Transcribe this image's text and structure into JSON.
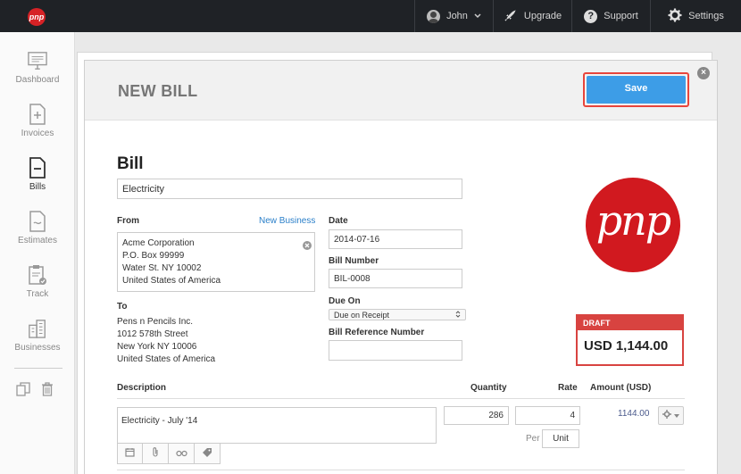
{
  "topbar": {
    "logo_text": "pnp",
    "user": "John",
    "upgrade": "Upgrade",
    "support": "Support",
    "settings": "Settings"
  },
  "sidebar": {
    "items": [
      {
        "label": "Dashboard",
        "icon": "monitor-icon"
      },
      {
        "label": "Invoices",
        "icon": "invoice-plus-icon"
      },
      {
        "label": "Bills",
        "icon": "bill-minus-icon"
      },
      {
        "label": "Estimates",
        "icon": "estimate-icon"
      },
      {
        "label": "Track",
        "icon": "clipboard-check-icon"
      },
      {
        "label": "Businesses",
        "icon": "buildings-icon"
      }
    ],
    "active": "Bills",
    "tools": [
      "copy-icon",
      "trash-icon"
    ]
  },
  "card": {
    "title": "NEW BILL",
    "save_label": "Save"
  },
  "bill": {
    "heading": "Bill",
    "name": "Electricity",
    "from_label": "From",
    "new_business_link": "New Business",
    "from_lines": [
      "Acme Corporation",
      "P.O. Box 99999",
      "Water St. NY 10002",
      "United States of America"
    ],
    "to_label": "To",
    "to_lines": [
      "Pens n Pencils Inc.",
      "1012 578th Street",
      "New York NY 10006",
      "United States of America"
    ],
    "date_label": "Date",
    "date_value": "2014-07-16",
    "bill_number_label": "Bill Number",
    "bill_number_value": "BIL-0008",
    "due_on_label": "Due On",
    "due_on_value": "Due on Receipt",
    "reference_label": "Bill Reference Number",
    "reference_value": ""
  },
  "status": {
    "badge": "DRAFT",
    "total": "USD 1,144.00",
    "brand_text": "pnp"
  },
  "lines": {
    "headers": {
      "description": "Description",
      "quantity": "Quantity",
      "rate": "Rate",
      "amount": "Amount (USD)"
    },
    "items": [
      {
        "description": "Electricity  - July '14",
        "quantity": "286",
        "rate": "4",
        "per_label": "Per",
        "unit": "Unit",
        "amount": "1144.00"
      }
    ]
  }
}
